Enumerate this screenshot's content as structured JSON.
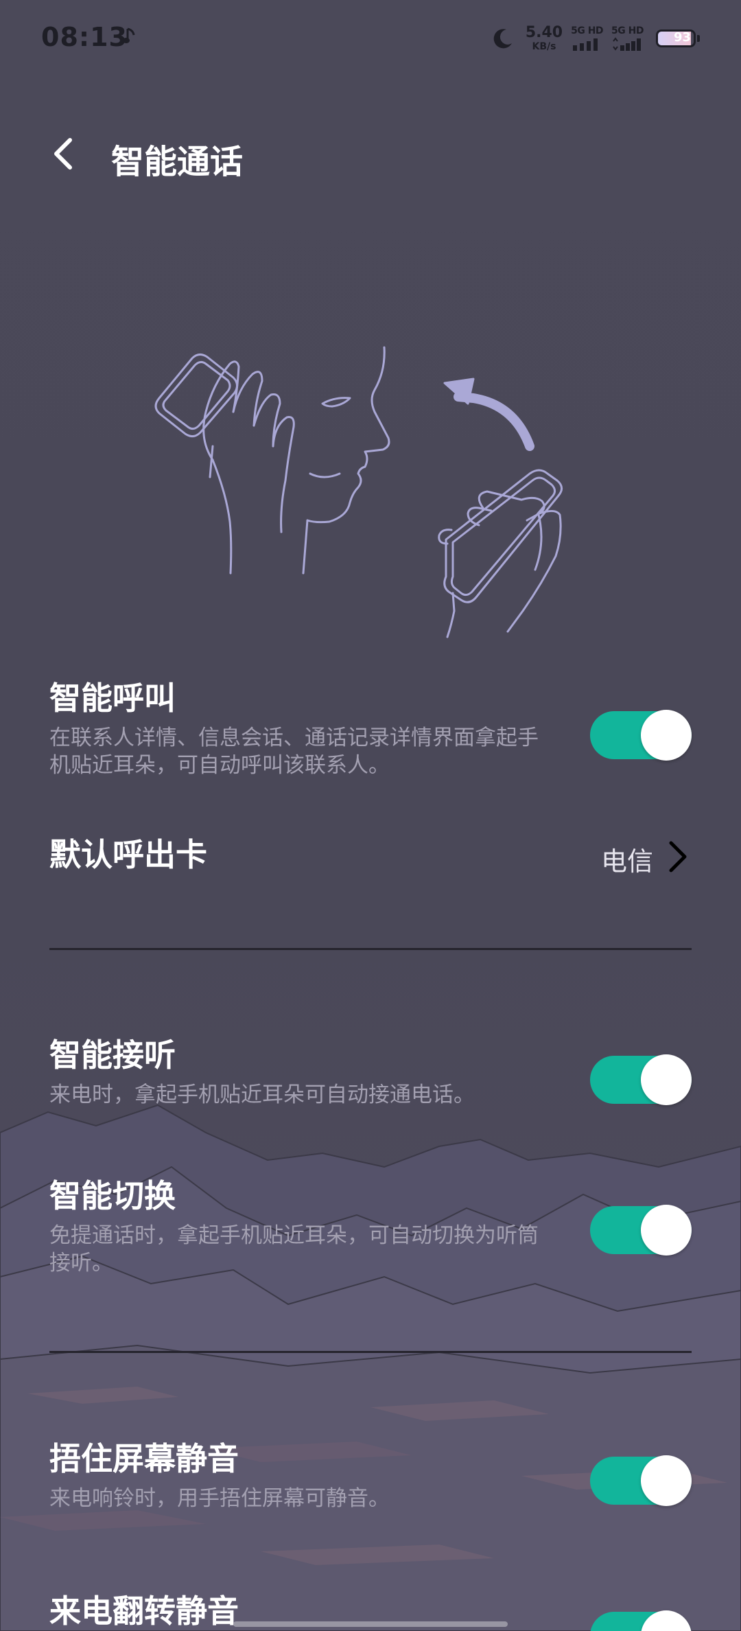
{
  "status_bar": {
    "time": "08:13",
    "net_speed_value": "5.40",
    "net_speed_unit": "KB/s",
    "sim1_label": "5G HD",
    "sim2_label": "5G HD",
    "battery_level": "93",
    "icons": [
      "music-note-icon",
      "moon-icon",
      "signal-icon",
      "battery-icon"
    ]
  },
  "header": {
    "title": "智能通话",
    "back_icon": "chevron-left-icon"
  },
  "settings": [
    {
      "id": "smart-call",
      "title": "智能呼叫",
      "description": "在联系人详情、信息会话、通话记录详情界面拿起手机贴近耳朵，可自动呼叫该联系人。",
      "enabled": true
    },
    {
      "id": "default-card",
      "title": "默认呼出卡",
      "value": "电信"
    },
    {
      "id": "smart-answer",
      "title": "智能接听",
      "description": "来电时，拿起手机贴近耳朵可自动接通电话。",
      "enabled": true
    },
    {
      "id": "smart-switch",
      "title": "智能切换",
      "description": "免提通话时，拿起手机贴近耳朵，可自动切换为听筒接听。",
      "enabled": true
    },
    {
      "id": "cover-mute",
      "title": "捂住屏幕静音",
      "description": "来电响铃时，用手捂住屏幕可静音。",
      "enabled": true
    },
    {
      "id": "flip-mute",
      "title": "来电翻转静音",
      "enabled": true
    }
  ],
  "colors": {
    "background": "#4a4858",
    "toggle_on": "#12b59b",
    "description_text": "#a3a0b1",
    "illustration_accent": "#aaa8d6"
  }
}
